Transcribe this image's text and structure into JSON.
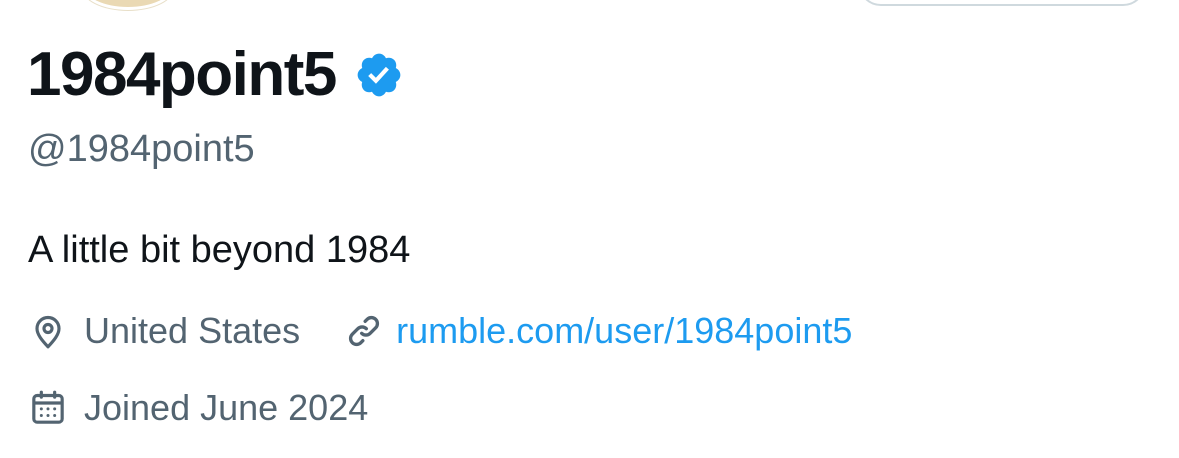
{
  "profile": {
    "display_name": "1984point5",
    "handle": "@1984point5",
    "bio": "A little bit beyond 1984",
    "location": "United States",
    "website": "rumble.com/user/1984point5",
    "joined": "Joined June 2024"
  },
  "icons": {
    "verified": "verified-badge-icon",
    "location": "location-pin-icon",
    "website": "link-icon",
    "joined": "calendar-icon"
  },
  "colors": {
    "primary_text": "#0f1419",
    "secondary_text": "#536471",
    "link": "#1d9bf0",
    "verified": "#1d9bf0"
  }
}
